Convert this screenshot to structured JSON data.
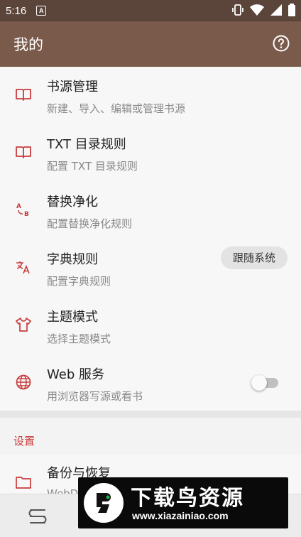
{
  "status_bar": {
    "time": "5:16",
    "notification_glyph": "A"
  },
  "app_bar": {
    "title": "我的",
    "help_icon": "help-circle-icon"
  },
  "items": [
    {
      "title": "书源管理",
      "subtitle": "新建、导入、编辑或管理书源",
      "icon": "book-open-icon"
    },
    {
      "title": "TXT 目录规则",
      "subtitle": "配置 TXT 目录规则",
      "icon": "book-open-icon"
    },
    {
      "title": "替换净化",
      "subtitle": "配置替换净化规则",
      "icon": "replace-ab-icon"
    },
    {
      "title": "字典规则",
      "subtitle": "配置字典规则",
      "icon": "translate-icon"
    },
    {
      "title": "主题模式",
      "subtitle": "选择主题模式",
      "icon": "tshirt-icon",
      "value": "跟随系统"
    },
    {
      "title": "Web 服务",
      "subtitle": "用浏览器写源或看书",
      "icon": "globe-icon",
      "toggle_on": false
    }
  ],
  "settings": {
    "section_label": "设置"
  },
  "backup": {
    "title": "备份与恢复",
    "subtitle": "WebD",
    "icon": "folder-icon"
  },
  "watermark": {
    "brand": "下载鸟资源",
    "url": "www.xiazainiao.com"
  },
  "colors": {
    "app_bar": "#7a5a4a",
    "status_bar": "#5b443a",
    "accent": "#c83c3c"
  }
}
